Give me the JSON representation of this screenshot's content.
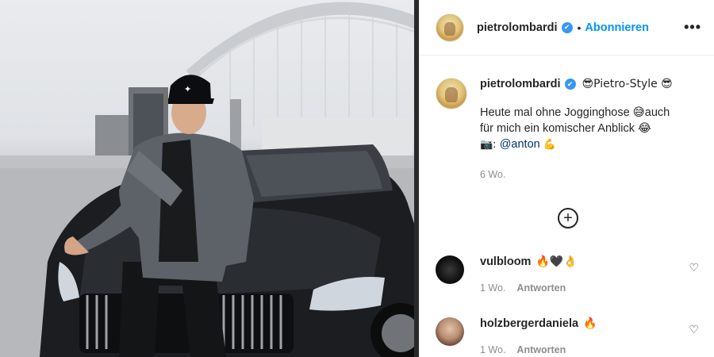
{
  "post": {
    "author": "pietrolombardi",
    "verified_mark": "✔",
    "separator": "•",
    "follow_label": "Abonnieren",
    "more_label": "•••",
    "caption_title": "😎Pietro-Style 😎",
    "caption_line1": "Heute mal ohne Jogginghose 😅auch",
    "caption_line2": "für mich ein komischer Anblick 😂",
    "caption_camera": "📷: ",
    "caption_mention": "@anton",
    "caption_flex": " 💪",
    "age": "6 Wo.",
    "add_comments_icon": "⊕"
  },
  "comments": [
    {
      "user": "vulbloom",
      "emojis": "🔥🖤👌",
      "age": "1 Wo.",
      "reply_label": "Antworten",
      "like_icon": "♡"
    },
    {
      "user": "holzbergerdaniela",
      "emojis": "🔥",
      "age": "1 Wo.",
      "reply_label": "Antworten",
      "like_icon": "♡"
    }
  ],
  "colors": {
    "accent": "#0095f6",
    "verified": "#3897f0",
    "muted": "#8e8e8e",
    "text": "#262626"
  },
  "icons": [
    "verified-badge-icon",
    "more-options-icon",
    "add-comments-icon",
    "heart-icon",
    "camera-emoji",
    "sunglasses-emoji"
  ]
}
